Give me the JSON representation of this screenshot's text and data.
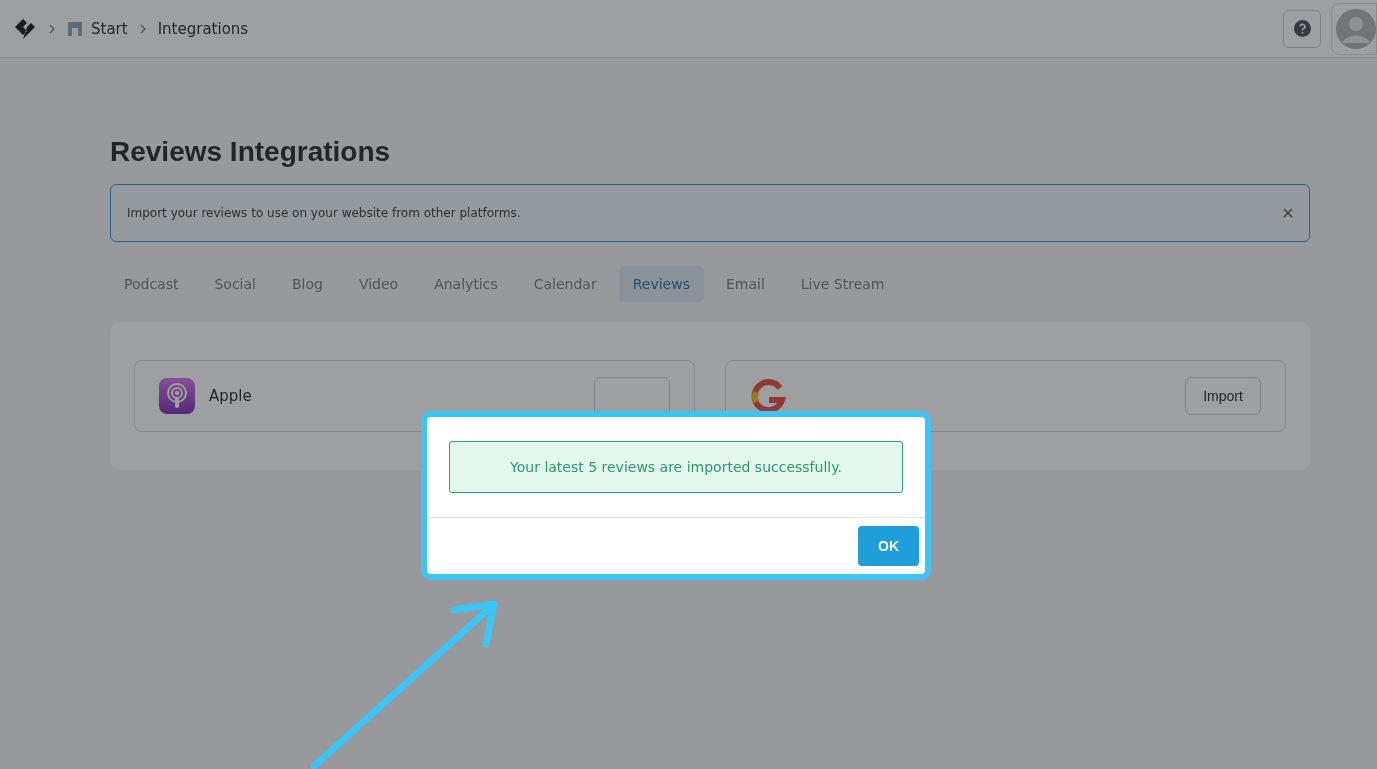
{
  "topbar": {
    "breadcrumbs": [
      {
        "label": "Start",
        "kind": "store"
      },
      {
        "label": "Integrations",
        "kind": "plain"
      }
    ]
  },
  "page": {
    "title": "Reviews Integrations",
    "notice": "Import your reviews to use on your website from other platforms."
  },
  "tabs": [
    {
      "label": "Podcast",
      "selected": false
    },
    {
      "label": "Social",
      "selected": false
    },
    {
      "label": "Blog",
      "selected": false
    },
    {
      "label": "Video",
      "selected": false
    },
    {
      "label": "Analytics",
      "selected": false
    },
    {
      "label": "Calendar",
      "selected": false
    },
    {
      "label": "Reviews",
      "selected": true
    },
    {
      "label": "Email",
      "selected": false
    },
    {
      "label": "Live Stream",
      "selected": false
    }
  ],
  "integrations": [
    {
      "kind": "podcast",
      "name": "Apple"
    },
    {
      "kind": "google",
      "button": "Import"
    }
  ],
  "dialog": {
    "message": "Your latest 5 reviews are imported successfully.",
    "button": "OK"
  }
}
